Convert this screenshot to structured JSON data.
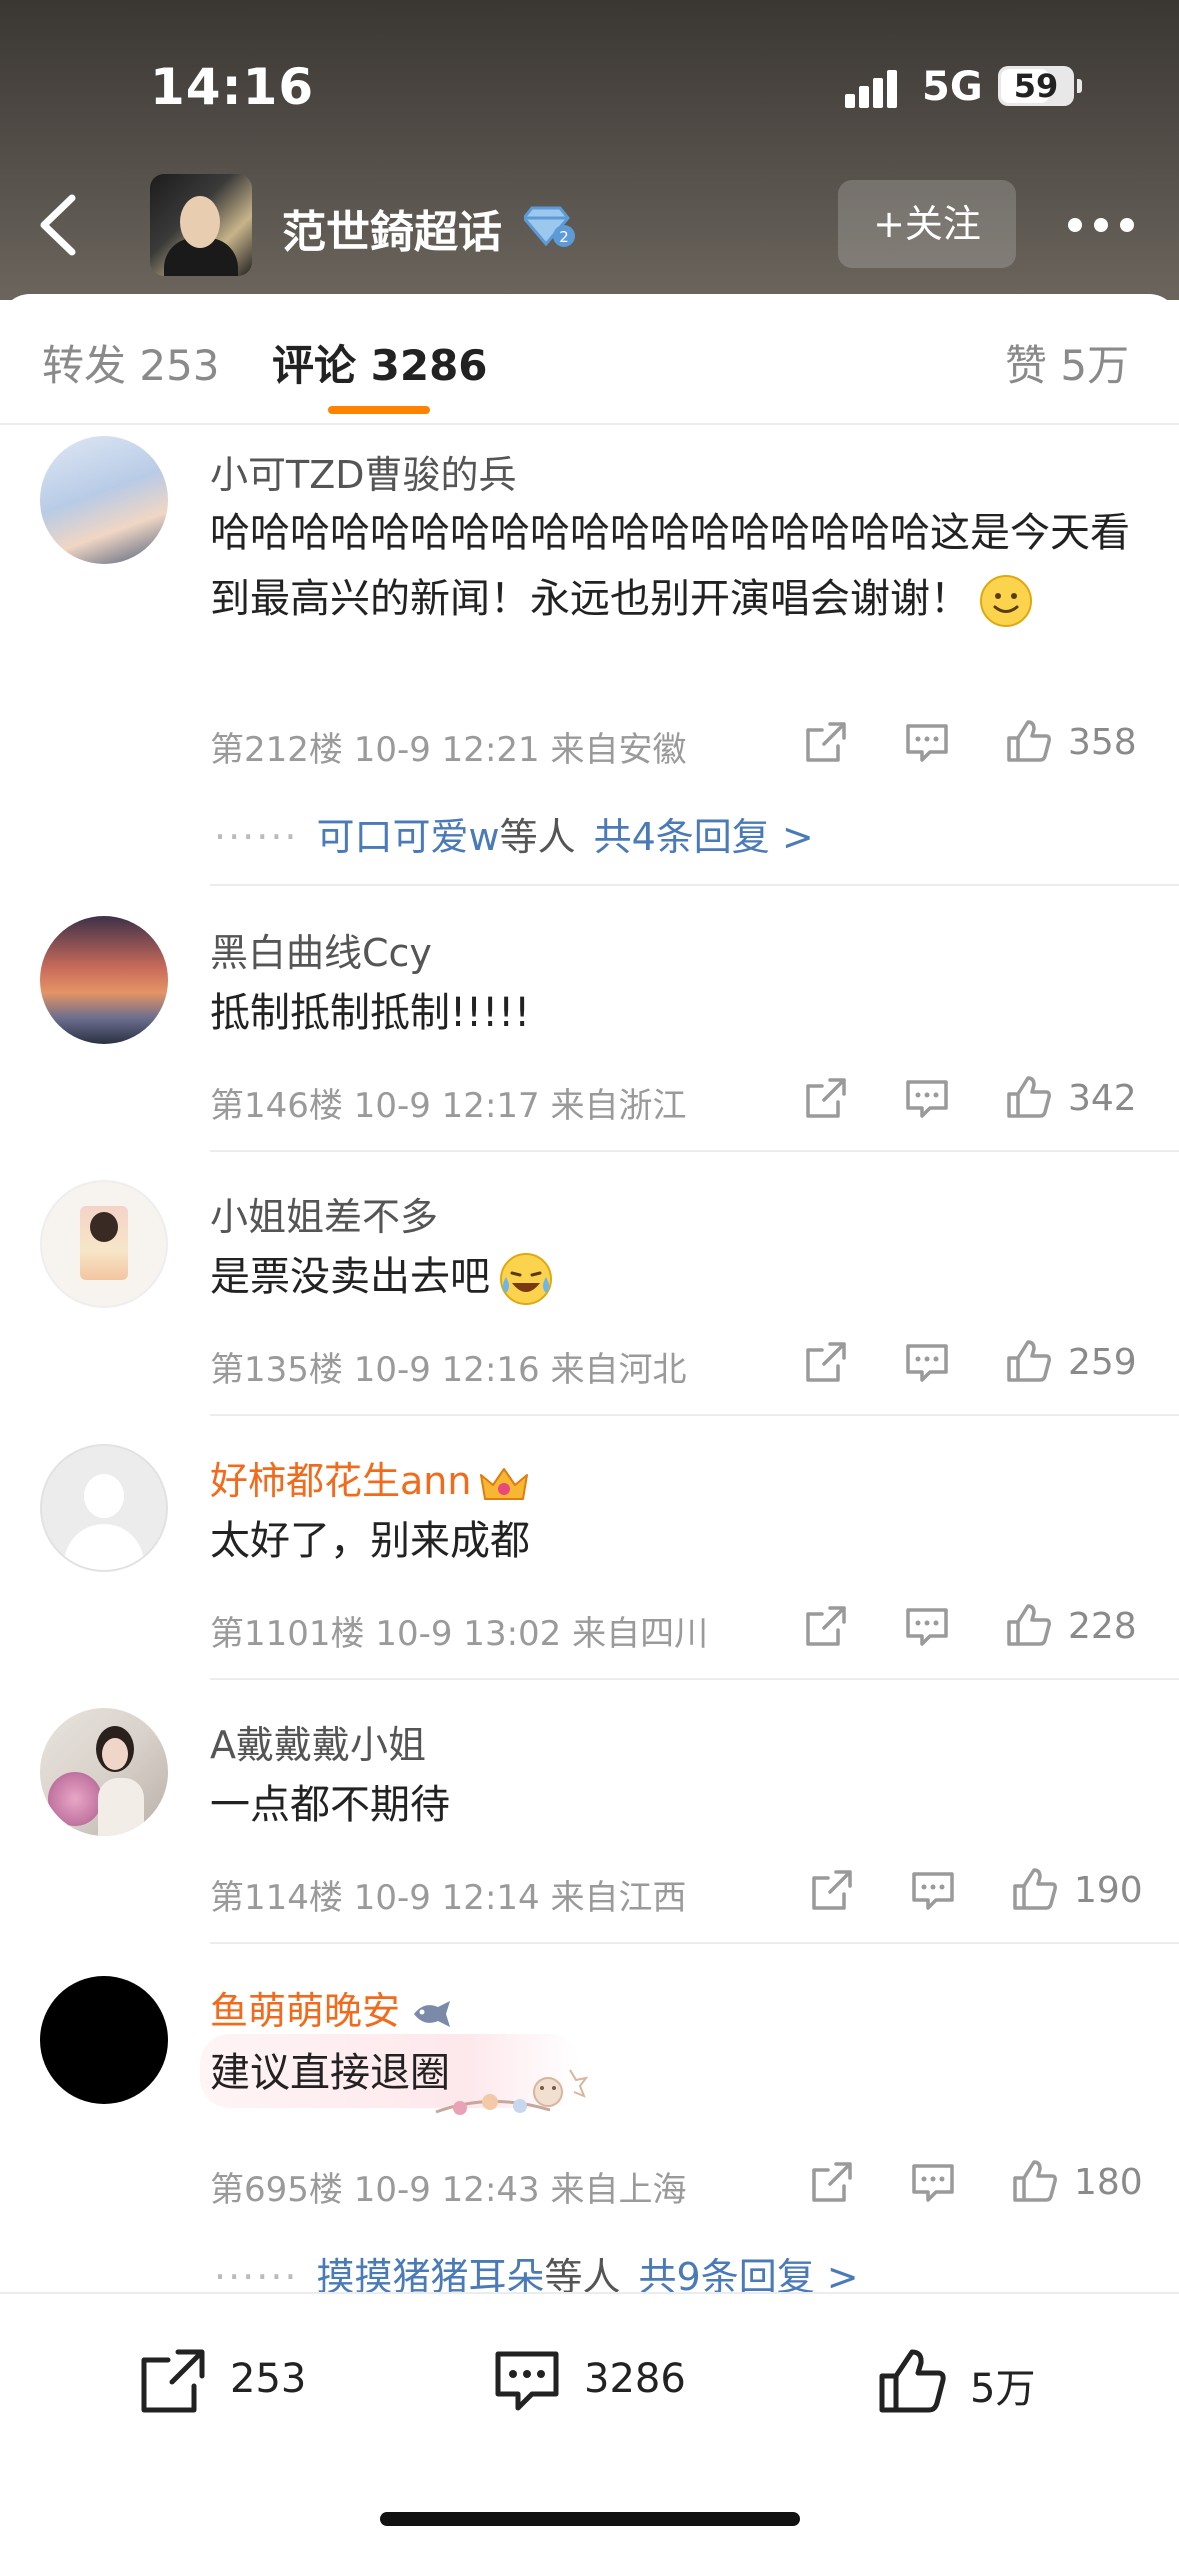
{
  "status": {
    "time": "14:16",
    "network": "5G",
    "battery": "59"
  },
  "header": {
    "topic_title": "范世錡超话",
    "follow_label": "+关注"
  },
  "tabs": {
    "repost": "转发 253",
    "comment": "评论 3286",
    "like": "赞 5万"
  },
  "comments": [
    {
      "name": "小可TZD曹骏的兵",
      "text": "哈哈哈哈哈哈哈哈哈哈哈哈哈哈哈哈哈哈这是今天看到最高兴的新闻！永远也别开演唱会谢谢！",
      "emoji": "smile-emoji",
      "meta": "第212楼  10-9 12:21  来自安徽",
      "likes": "358",
      "replies": {
        "who": "可口可爱w",
        "mid": "等人",
        "total": "共4条回复 >"
      }
    },
    {
      "name": "黑白曲线Ccy",
      "text": "抵制抵制抵制!!!!!",
      "meta": "第146楼  10-9 12:17  来自浙江",
      "likes": "342"
    },
    {
      "name": "小姐姐差不多",
      "text": "是票没卖出去吧",
      "emoji": "crying-laugh-emoji",
      "meta": "第135楼  10-9 12:16  来自河北",
      "likes": "259"
    },
    {
      "name": "好柿都花生ann",
      "name_color": "#f26b1d",
      "badge": "crown-icon",
      "text": "太好了，别来成都",
      "meta": "第1101楼  10-9 13:02  来自四川",
      "likes": "228"
    },
    {
      "name": "A戴戴戴小姐",
      "text": "一点都不期待",
      "meta": "第114楼  10-9 12:14  来自江西",
      "likes": "190"
    },
    {
      "name": "鱼萌萌晚安",
      "name_color": "#f26b1d",
      "badge": "fish-icon",
      "text": "建议直接退圈",
      "meta": "第695楼  10-9 12:43  来自上海",
      "likes": "180",
      "replies": {
        "who": "摸摸猪猪耳朵",
        "mid": "等人",
        "total": "共9条回复 >"
      }
    }
  ],
  "bottom_bar": {
    "repost_count": "253",
    "comment_count": "3286",
    "like_count": "5万"
  },
  "colors": {
    "accent": "#ff8200",
    "link": "#4a7ab8",
    "vip_name": "#f26b1d"
  }
}
